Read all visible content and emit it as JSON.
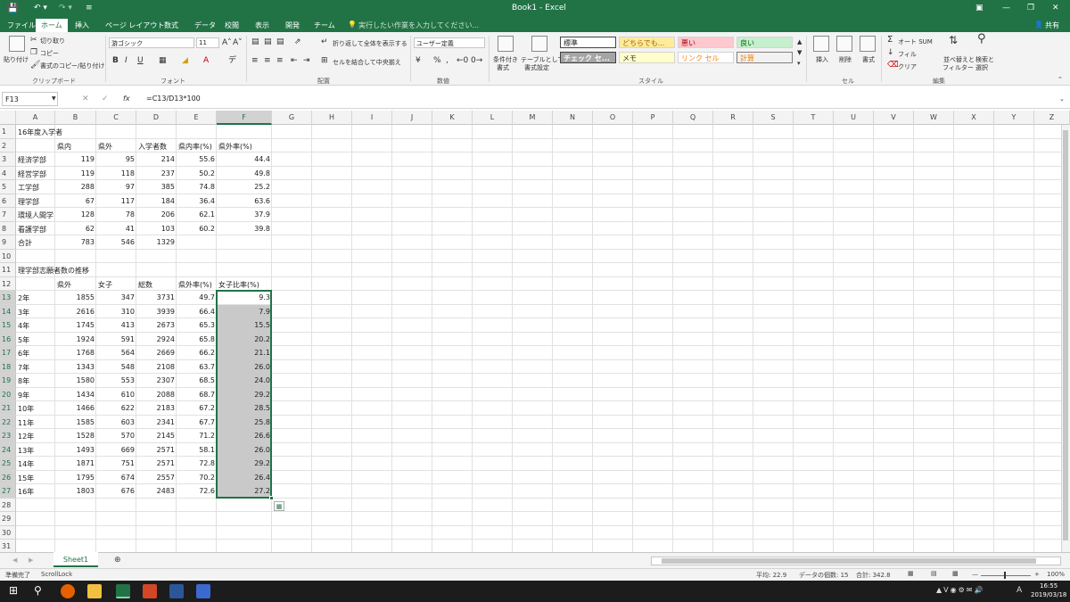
{
  "titlebar": {
    "title": "Book1 - Excel",
    "share": "共有"
  },
  "ribbon_tabs": [
    "ファイル",
    "ホーム",
    "挿入",
    "ページ レイアウト",
    "数式",
    "データ",
    "校閲",
    "表示",
    "開発",
    "チーム"
  ],
  "tell_me": "実行したい作業を入力してください...",
  "clipboard": {
    "paste": "貼り付け",
    "cut": "切り取り",
    "copy": "コピー",
    "format_painter": "書式のコピー/貼り付け",
    "label": "クリップボード"
  },
  "font": {
    "name": "游ゴシック",
    "size": "11",
    "bold": "B",
    "italic": "I",
    "underline": "U",
    "label": "フォント"
  },
  "alignment": {
    "wrap": "折り返して全体を表示する",
    "merge": "セルを結合して中央揃え",
    "label": "配置"
  },
  "number": {
    "format": "ユーザー定義",
    "label": "数値"
  },
  "styles": {
    "conditional": [
      "条件付き",
      "書式"
    ],
    "table": [
      "テーブルとして",
      "書式設定"
    ],
    "items": [
      "標準",
      "どちらでも...",
      "悪い",
      "良い",
      "チェック セ...",
      "メモ",
      "リンク セル",
      "計算"
    ],
    "label": "スタイル"
  },
  "cells": {
    "insert": "挿入",
    "delete": "削除",
    "format": "書式",
    "label": "セル"
  },
  "editing": {
    "autosum": "オート SUM",
    "fill": "フィル",
    "clear": "クリア",
    "sort": [
      "並べ替えと",
      "フィルター"
    ],
    "find": [
      "検索と",
      "選択"
    ],
    "label": "編集"
  },
  "formula_bar": {
    "name_box": "F13",
    "fx": "fx",
    "formula": "=C13/D13*100"
  },
  "columns": [
    "A",
    "B",
    "C",
    "D",
    "E",
    "F",
    "G",
    "H",
    "I",
    "J",
    "K",
    "L",
    "M",
    "N",
    "O",
    "P",
    "Q",
    "R",
    "S",
    "T",
    "U",
    "V",
    "W",
    "X",
    "Y",
    "Z"
  ],
  "rows": [
    {
      "n": "1",
      "v": [
        "16年度入学者",
        "",
        "",
        "",
        "",
        ""
      ]
    },
    {
      "n": "2",
      "v": [
        "",
        "県内",
        "県外",
        "入学者数",
        "県内率(%)",
        "県外率(%)"
      ]
    },
    {
      "n": "3",
      "v": [
        "経済学部",
        "119",
        "95",
        "214",
        "55.6",
        "44.4"
      ]
    },
    {
      "n": "4",
      "v": [
        "経営学部",
        "119",
        "118",
        "237",
        "50.2",
        "49.8"
      ]
    },
    {
      "n": "5",
      "v": [
        "工学部",
        "288",
        "97",
        "385",
        "74.8",
        "25.2"
      ]
    },
    {
      "n": "6",
      "v": [
        "理学部",
        "67",
        "117",
        "184",
        "36.4",
        "63.6"
      ]
    },
    {
      "n": "7",
      "v": [
        "環境人間学",
        "128",
        "78",
        "206",
        "62.1",
        "37.9"
      ]
    },
    {
      "n": "8",
      "v": [
        "看護学部",
        "62",
        "41",
        "103",
        "60.2",
        "39.8"
      ]
    },
    {
      "n": "9",
      "v": [
        "合計",
        "783",
        "546",
        "1329",
        "",
        ""
      ]
    },
    {
      "n": "10",
      "v": [
        "",
        "",
        "",
        "",
        "",
        ""
      ]
    },
    {
      "n": "11",
      "v": [
        "理学部志願者数の推移",
        "",
        "",
        "",
        "",
        ""
      ]
    },
    {
      "n": "12",
      "v": [
        "",
        "県外",
        "女子",
        "総数",
        "県外率(%)",
        "女子比率(%)"
      ]
    },
    {
      "n": "13",
      "v": [
        "2年",
        "1855",
        "347",
        "3731",
        "49.7",
        "9.3"
      ]
    },
    {
      "n": "14",
      "v": [
        "3年",
        "2616",
        "310",
        "3939",
        "66.4",
        "7.9"
      ]
    },
    {
      "n": "15",
      "v": [
        "4年",
        "1745",
        "413",
        "2673",
        "65.3",
        "15.5"
      ]
    },
    {
      "n": "16",
      "v": [
        "5年",
        "1924",
        "591",
        "2924",
        "65.8",
        "20.2"
      ]
    },
    {
      "n": "17",
      "v": [
        "6年",
        "1768",
        "564",
        "2669",
        "66.2",
        "21.1"
      ]
    },
    {
      "n": "18",
      "v": [
        "7年",
        "1343",
        "548",
        "2108",
        "63.7",
        "26.0"
      ]
    },
    {
      "n": "19",
      "v": [
        "8年",
        "1580",
        "553",
        "2307",
        "68.5",
        "24.0"
      ]
    },
    {
      "n": "20",
      "v": [
        "9年",
        "1434",
        "610",
        "2088",
        "68.7",
        "29.2"
      ]
    },
    {
      "n": "21",
      "v": [
        "10年",
        "1466",
        "622",
        "2183",
        "67.2",
        "28.5"
      ]
    },
    {
      "n": "22",
      "v": [
        "11年",
        "1585",
        "603",
        "2341",
        "67.7",
        "25.8"
      ]
    },
    {
      "n": "23",
      "v": [
        "12年",
        "1528",
        "570",
        "2145",
        "71.2",
        "26.6"
      ]
    },
    {
      "n": "24",
      "v": [
        "13年",
        "1493",
        "669",
        "2571",
        "58.1",
        "26.0"
      ]
    },
    {
      "n": "25",
      "v": [
        "14年",
        "1871",
        "751",
        "2571",
        "72.8",
        "29.2"
      ]
    },
    {
      "n": "26",
      "v": [
        "15年",
        "1795",
        "674",
        "2557",
        "70.2",
        "26.4"
      ]
    },
    {
      "n": "27",
      "v": [
        "16年",
        "1803",
        "676",
        "2483",
        "72.6",
        "27.2"
      ]
    },
    {
      "n": "28",
      "v": [
        "",
        "",
        "",
        "",
        "",
        ""
      ]
    },
    {
      "n": "29",
      "v": [
        "",
        "",
        "",
        "",
        "",
        ""
      ]
    },
    {
      "n": "30",
      "v": [
        "",
        "",
        "",
        "",
        "",
        ""
      ]
    },
    {
      "n": "31",
      "v": [
        "",
        "",
        "",
        "",
        "",
        ""
      ]
    }
  ],
  "sheet_tab": "Sheet1",
  "status": {
    "ready": "準備完了",
    "scroll_lock": "ScrollLock",
    "average": "平均: 22.9",
    "count": "データの個数: 15",
    "sum": "合計: 342.8",
    "zoom": "100%"
  },
  "taskbar": {
    "time": "16:55",
    "date": "2019/03/18"
  },
  "colors": {
    "accent": "#217346",
    "selection_fill": "#c9c9c9"
  }
}
